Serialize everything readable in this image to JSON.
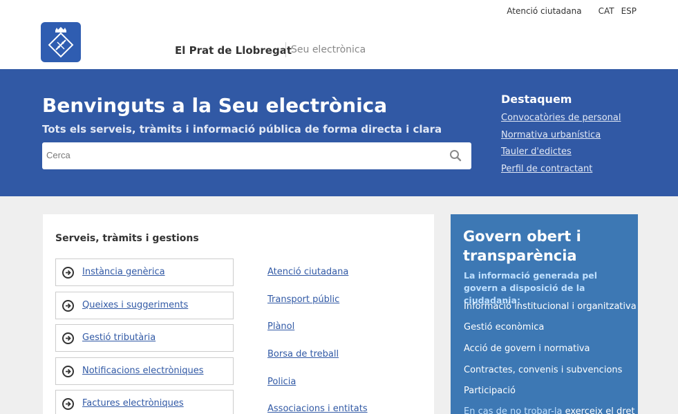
{
  "header": {
    "top_links": {
      "atencio": "Atenció ciutadana",
      "cat": "CAT",
      "esp": "ESP"
    },
    "site_name": "El Prat de Llobregat",
    "site_sub": "Seu electrònica"
  },
  "hero": {
    "title": "Benvinguts a la Seu electrònica",
    "subtitle": "Tots els serveis, tràmits i informació pública de forma directa i clara",
    "search_placeholder": "Cerca",
    "destaquem": {
      "title": "Destaquem",
      "links": [
        "Convocatòries de personal",
        "Normativa urbanística",
        "Tauler d'edictes",
        "Perfil de contractant"
      ]
    }
  },
  "services": {
    "title": "Serveis, tràmits i gestions",
    "boxes": [
      "Instància genèrica",
      "Queixes i suggeriments",
      "Gestió tributària",
      "Notificacions electròniques",
      "Factures electròniques"
    ],
    "links": [
      "Atenció ciutadana",
      "Transport públic",
      "Plànol",
      "Borsa de treball",
      "Policia",
      "Associacions i entitats"
    ]
  },
  "govern": {
    "title": "Govern obert i transparència",
    "intro": "La informació generada pel govern a disposició de la ciudadania:",
    "links": [
      "Informació institucional i organitzativa",
      "Gestió econòmica",
      "Acció de govern i normativa",
      "Contractes, convenis i subvencions",
      "Participació"
    ],
    "foot_prefix": "En cas de no trobar-la",
    "foot_link": "exerceix el dret"
  },
  "colors": {
    "brand_blue": "#3159a5",
    "panel_blue": "#3d78b4"
  }
}
